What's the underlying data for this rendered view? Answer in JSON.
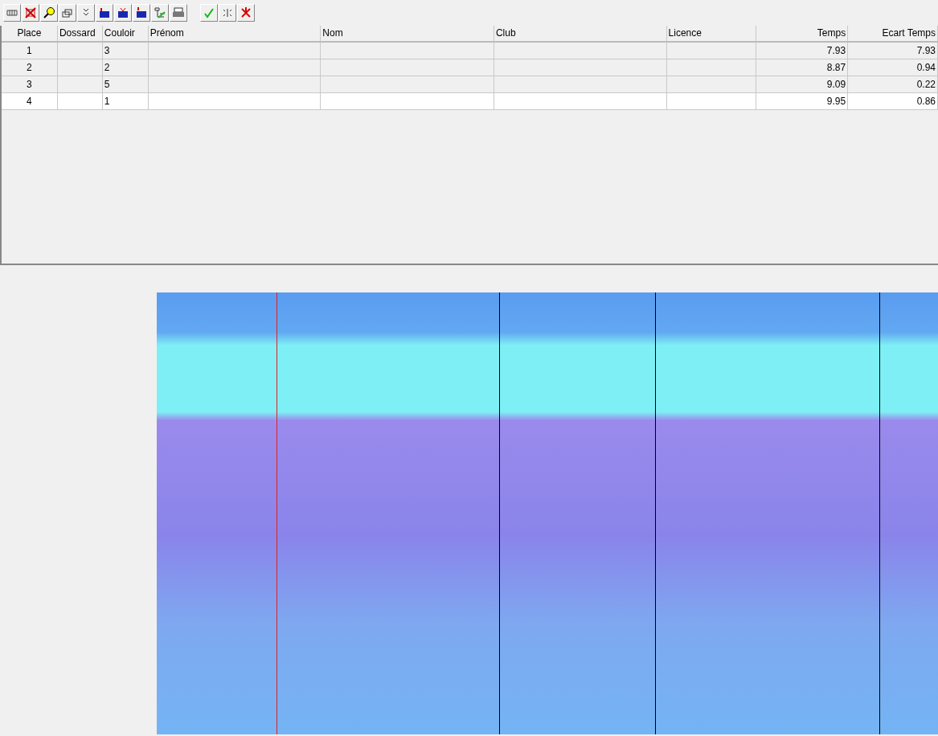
{
  "table": {
    "columns": [
      "Place",
      "Dossard",
      "Couloir",
      "Prénom",
      "Nom",
      "Club",
      "Licence",
      "Temps",
      "Ecart Temps"
    ],
    "rows": [
      {
        "highlighted": true,
        "cells": [
          "1",
          "",
          "3",
          "",
          "",
          "",
          "",
          "7.93",
          "7.93"
        ]
      },
      {
        "highlighted": true,
        "cells": [
          "2",
          "",
          "2",
          "",
          "",
          "",
          "",
          "8.87",
          "0.94"
        ]
      },
      {
        "highlighted": true,
        "cells": [
          "3",
          "",
          "5",
          "",
          "",
          "",
          "",
          "9.09",
          "0.22"
        ]
      },
      {
        "highlighted": false,
        "cells": [
          "4",
          "",
          "1",
          "",
          "",
          "",
          "",
          "9.95",
          "0.86"
        ]
      }
    ]
  }
}
